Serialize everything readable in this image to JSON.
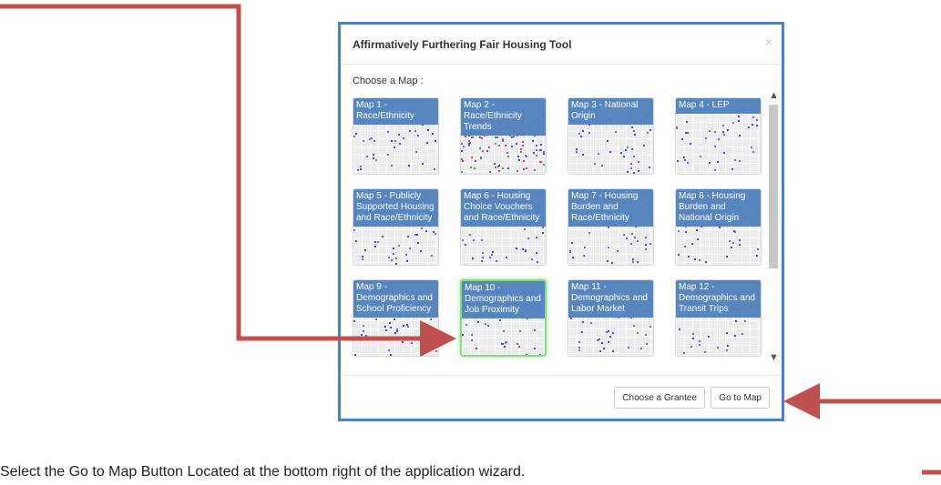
{
  "modal": {
    "title": "Affirmatively Furthering Fair Housing Tool",
    "close_glyph": "×",
    "choose_label": "Choose a Map :",
    "maps": [
      {
        "label": "Map 1 - Race/Ethnicity",
        "selected": false
      },
      {
        "label": "Map 2 - Race/Ethnicity Trends",
        "selected": false
      },
      {
        "label": "Map 3 - National Origin",
        "selected": false
      },
      {
        "label": "Map 4 - LEP",
        "selected": false
      },
      {
        "label": "Map 5 - Publicly Supported Housing and Race/Ethnicity",
        "selected": false
      },
      {
        "label": "Map 6 - Housing Choice Vouchers and Race/Ethnicity",
        "selected": false
      },
      {
        "label": "Map 7 - Housing Burden and Race/Ethnicity",
        "selected": false
      },
      {
        "label": "Map 8 - Housing Burden and National Origin",
        "selected": false
      },
      {
        "label": "Map 9 - Demographics and School Proficiency",
        "selected": false
      },
      {
        "label": "Map 10 - Demographics and Job Proximity",
        "selected": true
      },
      {
        "label": "Map 11 - Demographics and Labor Market",
        "selected": false
      },
      {
        "label": "Map 12 - Demographics and Transit Trips",
        "selected": false
      }
    ],
    "buttons": {
      "choose_grantee": "Choose a Grantee",
      "go_to_map": "Go to Map"
    }
  },
  "caption": "Select the Go to Map Button Located at the bottom right of the application wizard.",
  "colors": {
    "modal_border": "#4f81bd",
    "tile_label_bg": "#4f81bd",
    "selected_glow": "#86d986",
    "arrow": "#c0504d"
  }
}
